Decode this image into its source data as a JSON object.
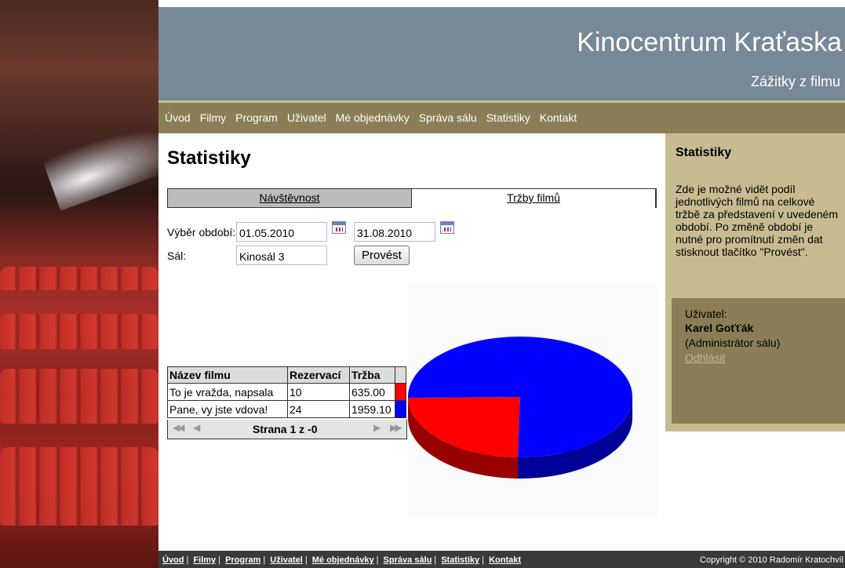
{
  "header": {
    "title": "Kinocentrum Kraťaska",
    "subtitle": "Zážitky z filmu"
  },
  "nav": {
    "items": [
      "Úvod",
      "Filmy",
      "Program",
      "Uživatel",
      "Mé objednávky",
      "Správa sálu",
      "Statistiky",
      "Kontakt"
    ]
  },
  "main": {
    "title": "Statistiky",
    "tabs": [
      {
        "label": "Návštěvnost",
        "active": false
      },
      {
        "label": "Tržby filmů",
        "active": true
      }
    ],
    "form": {
      "period_label": "Výběr období:",
      "date_from": "01.05.2010",
      "date_to": "31.08.2010",
      "hall_label": "Sál:",
      "hall_value": "Kinosál 3",
      "submit_label": "Provést"
    },
    "table": {
      "headers": [
        "Název filmu",
        "Rezervací",
        "Tržba"
      ],
      "rows": [
        {
          "film": "To je vražda, napsala",
          "reservations": "10",
          "revenue": "635.00",
          "color": "#ff0000"
        },
        {
          "film": "Pane, vy jste vdova!",
          "reservations": "24",
          "revenue": "1959.10",
          "color": "#0000ff"
        }
      ],
      "pager": {
        "text": "Strana 1 z -0",
        "first_icon": "first-page-icon",
        "prev_icon": "prev-page-icon",
        "next_icon": "next-page-icon",
        "last_icon": "last-page-icon"
      }
    }
  },
  "chart_data": {
    "type": "pie",
    "categories": [
      "To je vražda, napsala",
      "Pane, vy jste vdova!"
    ],
    "values": [
      635.0,
      1959.1
    ],
    "colors": [
      "#ff0000",
      "#0000ff"
    ],
    "title": ""
  },
  "sidebar": {
    "title": "Statistiky",
    "text": "Zde je možné vidět podíl jednotlivých filmů na celkové tržbě za představení v uvedeném období. Po změně období je nutné pro promítnutí změn dat stisknout tlačítko \"Provést\".",
    "user": {
      "label": "Uživatel:",
      "name": "Karel Goťťák",
      "role": "(Administrátor sálu)",
      "logout": "Odhlásit"
    }
  },
  "footer": {
    "links": [
      "Úvod",
      "Filmy",
      "Program",
      "Uživatel",
      "Mé objednávky",
      "Správa sálu",
      "Statistiky",
      "Kontakt"
    ],
    "separator": "|",
    "copyright": "Copyright © 2010 Radomír Kratochvíl"
  },
  "colors": {
    "header_bg": "#778899",
    "nav_bg": "#8b7d56",
    "sidebar_bg": "#c8bb92",
    "footer_bg": "#3a3a3a"
  }
}
